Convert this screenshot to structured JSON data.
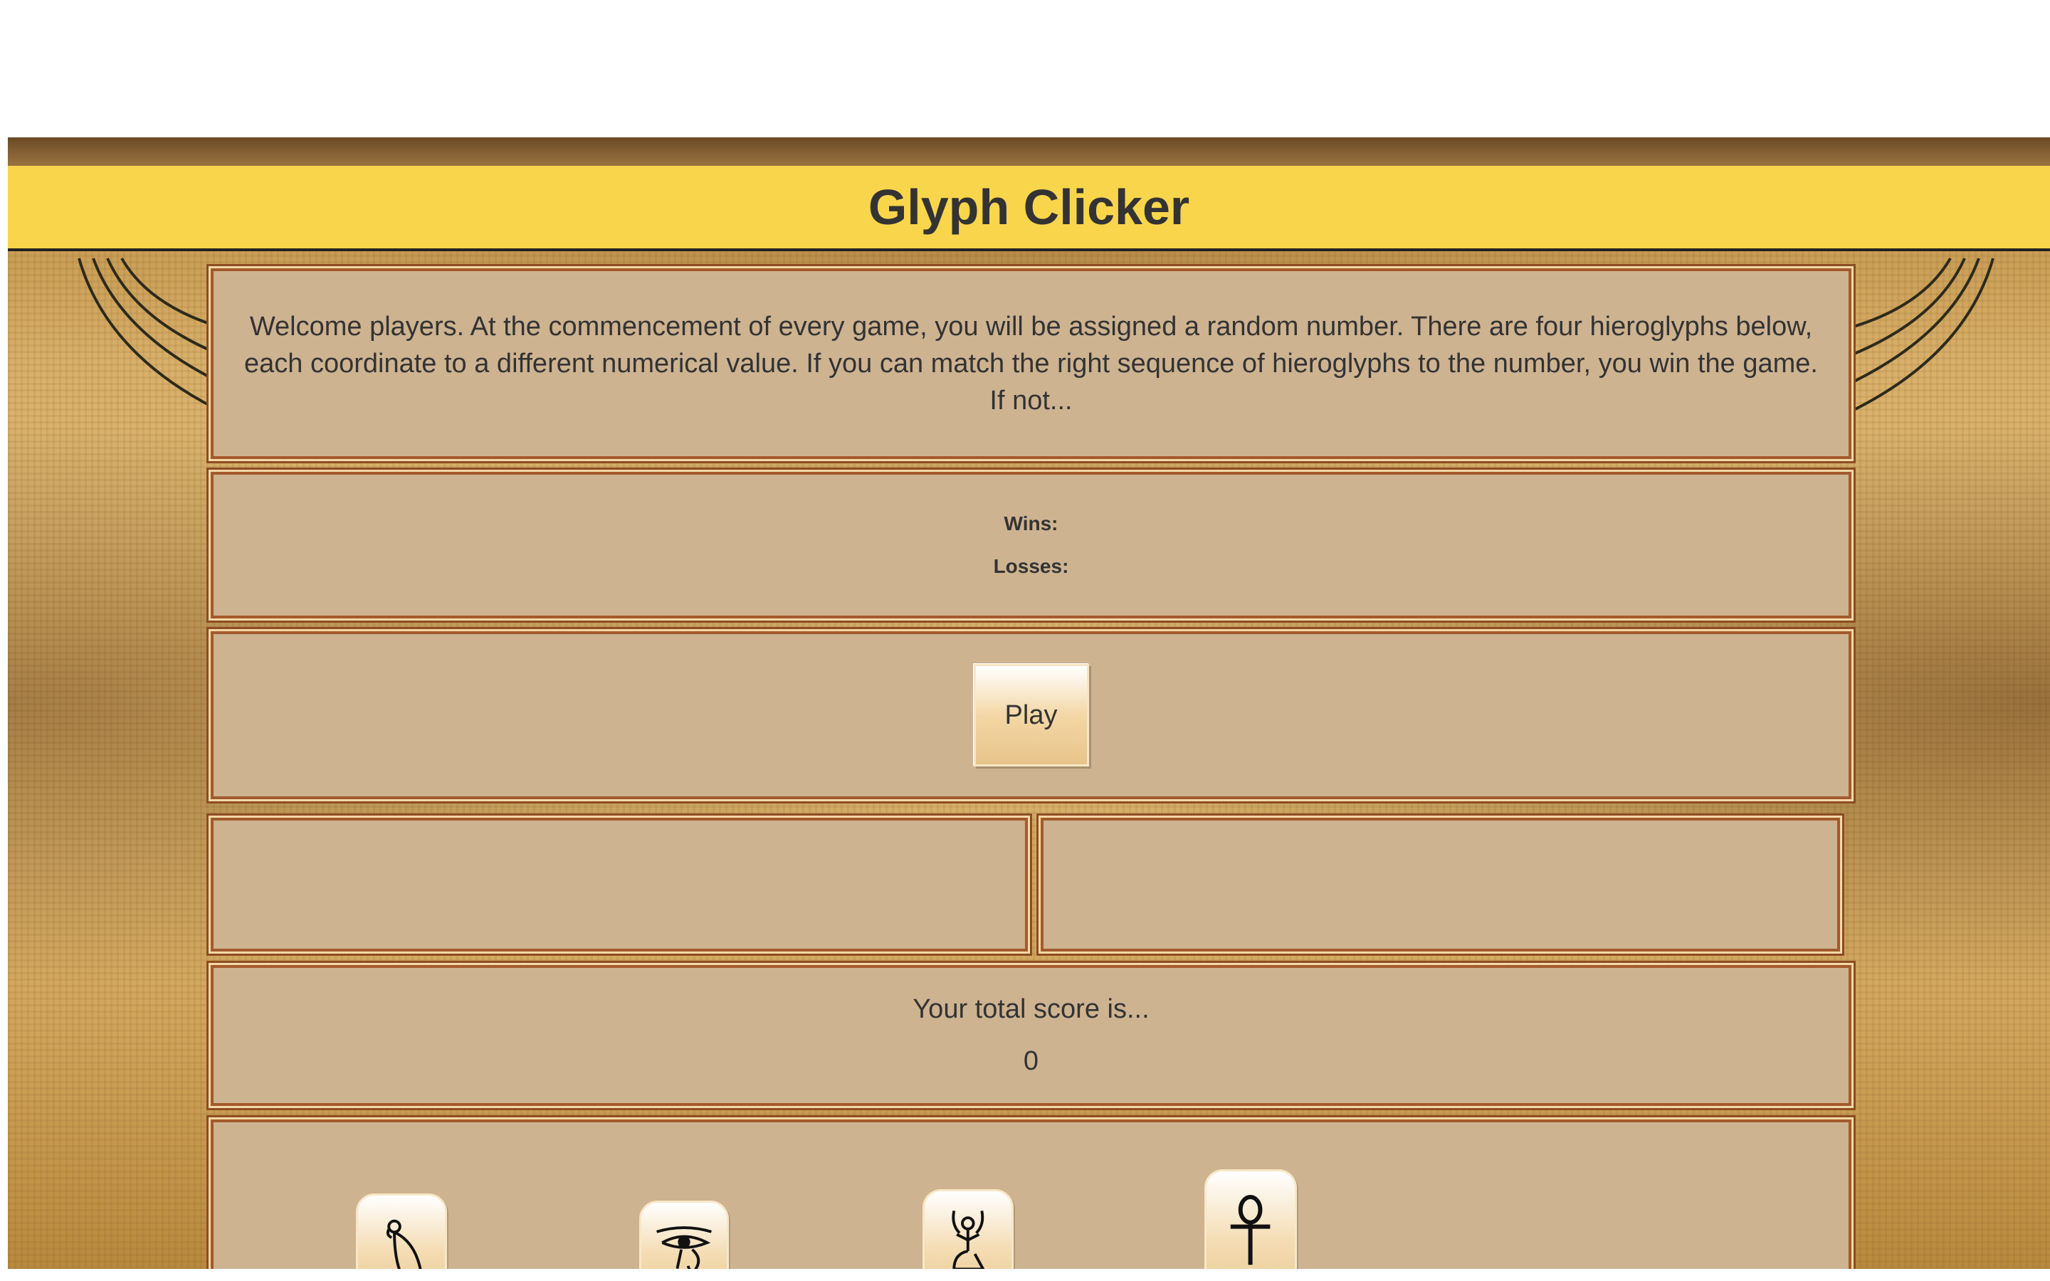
{
  "header": {
    "title": "Glyph Clicker"
  },
  "intro": {
    "text": "Welcome players. At the commencement of every game, you will be assigned a random number. There are four hieroglyphs below, each coordinate to a different numerical value. If you can match the right sequence of hieroglyphs to the number, you win the game. If not..."
  },
  "stats": {
    "wins_label": "Wins:",
    "losses_label": "Losses:"
  },
  "play": {
    "label": "Play"
  },
  "score": {
    "label": "Your total score is...",
    "value": "0"
  },
  "glyphs": [
    {
      "icon": "falcon-glyph-icon"
    },
    {
      "icon": "eye-of-horus-glyph-icon"
    },
    {
      "icon": "seated-god-glyph-icon"
    },
    {
      "icon": "ankh-glyph-icon"
    }
  ],
  "colors": {
    "title_bar": "#f8d54b",
    "panel_bg": "#ceb391",
    "panel_border": "#a35a2c",
    "text": "#333333"
  }
}
